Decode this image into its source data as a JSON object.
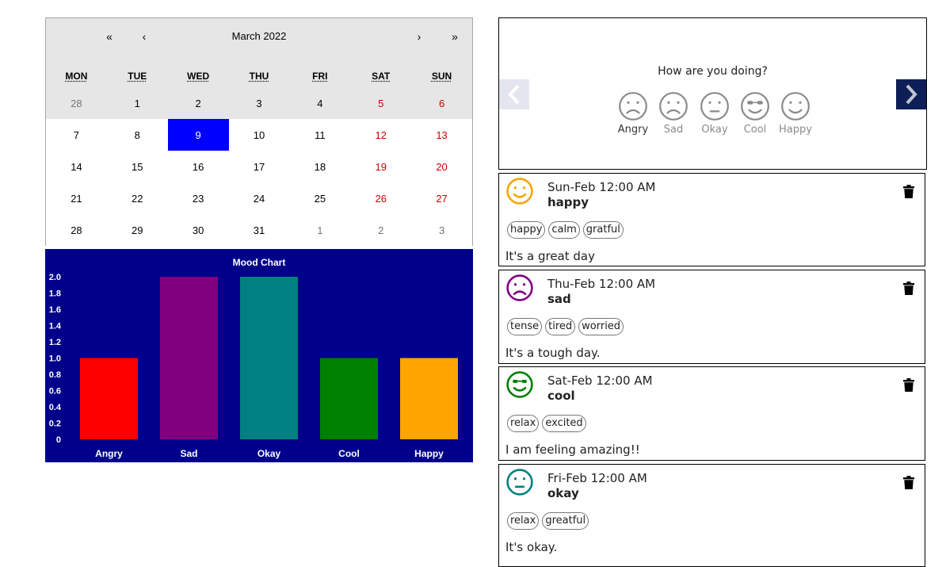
{
  "calendar": {
    "month_label": "March 2022",
    "nav": {
      "prev_year": "«",
      "prev_month": "‹",
      "next_month": "›",
      "next_year": "»"
    },
    "weekdays": [
      "MON",
      "TUE",
      "WED",
      "THU",
      "FRI",
      "SAT",
      "SUN"
    ],
    "weeks": [
      [
        "28",
        "1",
        "2",
        "3",
        "4",
        "5",
        "6"
      ],
      [
        "7",
        "8",
        "9",
        "10",
        "11",
        "12",
        "13"
      ],
      [
        "14",
        "15",
        "16",
        "17",
        "18",
        "19",
        "20"
      ],
      [
        "21",
        "22",
        "23",
        "24",
        "25",
        "26",
        "27"
      ],
      [
        "28",
        "29",
        "30",
        "31",
        "1",
        "2",
        "3"
      ]
    ],
    "selected_day": "9",
    "colors": {
      "selected": "#0000ff",
      "weekend": "#d10000",
      "muted": "#757575"
    }
  },
  "chart_data": {
    "type": "bar",
    "title": "Mood Chart",
    "categories": [
      "Angry",
      "Sad",
      "Okay",
      "Cool",
      "Happy"
    ],
    "values": [
      1,
      2,
      2,
      1,
      1
    ],
    "colors": [
      "#ff0000",
      "#800080",
      "#008080",
      "#008000",
      "#ffa500"
    ],
    "ylim": [
      0,
      2
    ],
    "yticks": [
      "0",
      "0.2",
      "0.4",
      "0.6",
      "0.8",
      "1.0",
      "1.2",
      "1.4",
      "1.6",
      "1.8",
      "2.0"
    ],
    "background": "#00008b",
    "grid": false
  },
  "picker": {
    "question": "How are you doing?",
    "moods": [
      {
        "label": "Angry",
        "icon": "frown-icon"
      },
      {
        "label": "Sad",
        "icon": "frown-icon"
      },
      {
        "label": "Okay",
        "icon": "neutral-face-icon"
      },
      {
        "label": "Cool",
        "icon": "sunglasses-face-icon"
      },
      {
        "label": "Happy",
        "icon": "smile-icon"
      }
    ],
    "prev_icon": "chevron-left-icon",
    "next_icon": "chevron-right-icon"
  },
  "entries": [
    {
      "date": "Sun-Feb 12:00 AM",
      "mood": "happy",
      "icon": "smile-icon",
      "color": "#f5a600",
      "tags": [
        "happy",
        "calm",
        "gratful"
      ],
      "note": "It's a great day"
    },
    {
      "date": "Thu-Feb 12:00 AM",
      "mood": "sad",
      "icon": "frown-icon",
      "color": "#800080",
      "tags": [
        "tense",
        "tired",
        "worried"
      ],
      "note": "It's a tough day."
    },
    {
      "date": "Sat-Feb 12:00 AM",
      "mood": "cool",
      "icon": "sunglasses-face-icon",
      "color": "#008000",
      "tags": [
        "relax",
        "excited"
      ],
      "note": "I am feeling amazing!!"
    },
    {
      "date": "Fri-Feb 12:00 AM",
      "mood": "okay",
      "icon": "neutral-face-icon",
      "color": "#008080",
      "tags": [
        "relax",
        "greatful"
      ],
      "note": "It's okay."
    }
  ]
}
